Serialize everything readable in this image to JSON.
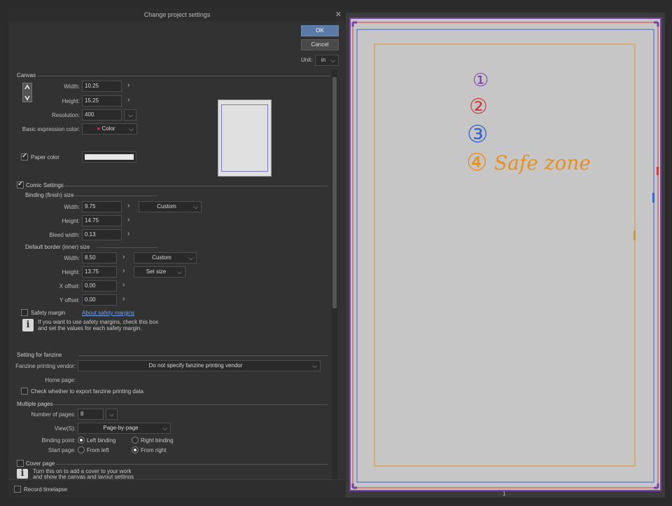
{
  "dialog": {
    "title": "Change project settings",
    "close": "✕",
    "ok_label": "OK",
    "cancel_label": "Cancel",
    "unit_label": "Unit:",
    "unit_value": "in"
  },
  "canvas": {
    "section": "Canvas",
    "width_label": "Width:",
    "width_value": "10.25",
    "height_label": "Height:",
    "height_value": "15.25",
    "resolution_label": "Resolution:",
    "resolution_value": "400",
    "expression_label": "Basic expression color:",
    "expression_value": "Color",
    "paper_color_label": "Paper color"
  },
  "comic": {
    "section": "Comic Settings",
    "binding_section": "Binding (finish) size",
    "width_label": "Width:",
    "width_value": "9.75",
    "width_preset": "Custom",
    "height_label": "Height:",
    "height_value": "14.75",
    "bleed_label": "Bleed width:",
    "bleed_value": "0.13",
    "border_section": "Default border (inner) size",
    "bwidth_label": "Width:",
    "bwidth_value": "8.50",
    "bwidth_preset": "Custom",
    "bheight_label": "Height:",
    "bheight_value": "13.75",
    "bheight_preset": "Set size",
    "xoff_label": "X offset:",
    "xoff_value": "0.00",
    "yoff_label": "Y offset:",
    "yoff_value": "0.00",
    "safety_label": "Safety margin",
    "safety_link": "About safety margins",
    "safety_info_1": "If you want to use safety margins, check this box",
    "safety_info_2": "and set the values for each safety margin."
  },
  "fanzine": {
    "section": "Setting for fanzine",
    "vendor_label": "Fanzine printing vendor:",
    "vendor_value": "Do not specify fanzine printing vendor",
    "homepage_label": "Home page:",
    "export_label": "Check whether to export fanzine printing data"
  },
  "multi": {
    "section": "Multiple pages",
    "pages_label": "Number of pages:",
    "pages_value": "8",
    "view_label": "View(S):",
    "view_value": "Page-by-page",
    "binding_label": "Binding point:",
    "left_binding": "Left binding",
    "right_binding": "Right binding",
    "start_label": "Start page:",
    "from_left": "From left",
    "from_right": "From right"
  },
  "cover": {
    "label": "Cover page",
    "info_1": "Turn this on to add a cover to your work",
    "info_2": "and show the canvas and layout settings"
  },
  "timelapse_label": "Record timelapse",
  "preview": {
    "markers": [
      "①",
      "②",
      "③",
      "④"
    ],
    "safe_zone_label": "Safe zone",
    "page_number": "1",
    "colors": {
      "purple": "#7a3fa8",
      "red": "#d43a3a",
      "blue": "#3a64d0",
      "orange": "#e8901e"
    }
  }
}
